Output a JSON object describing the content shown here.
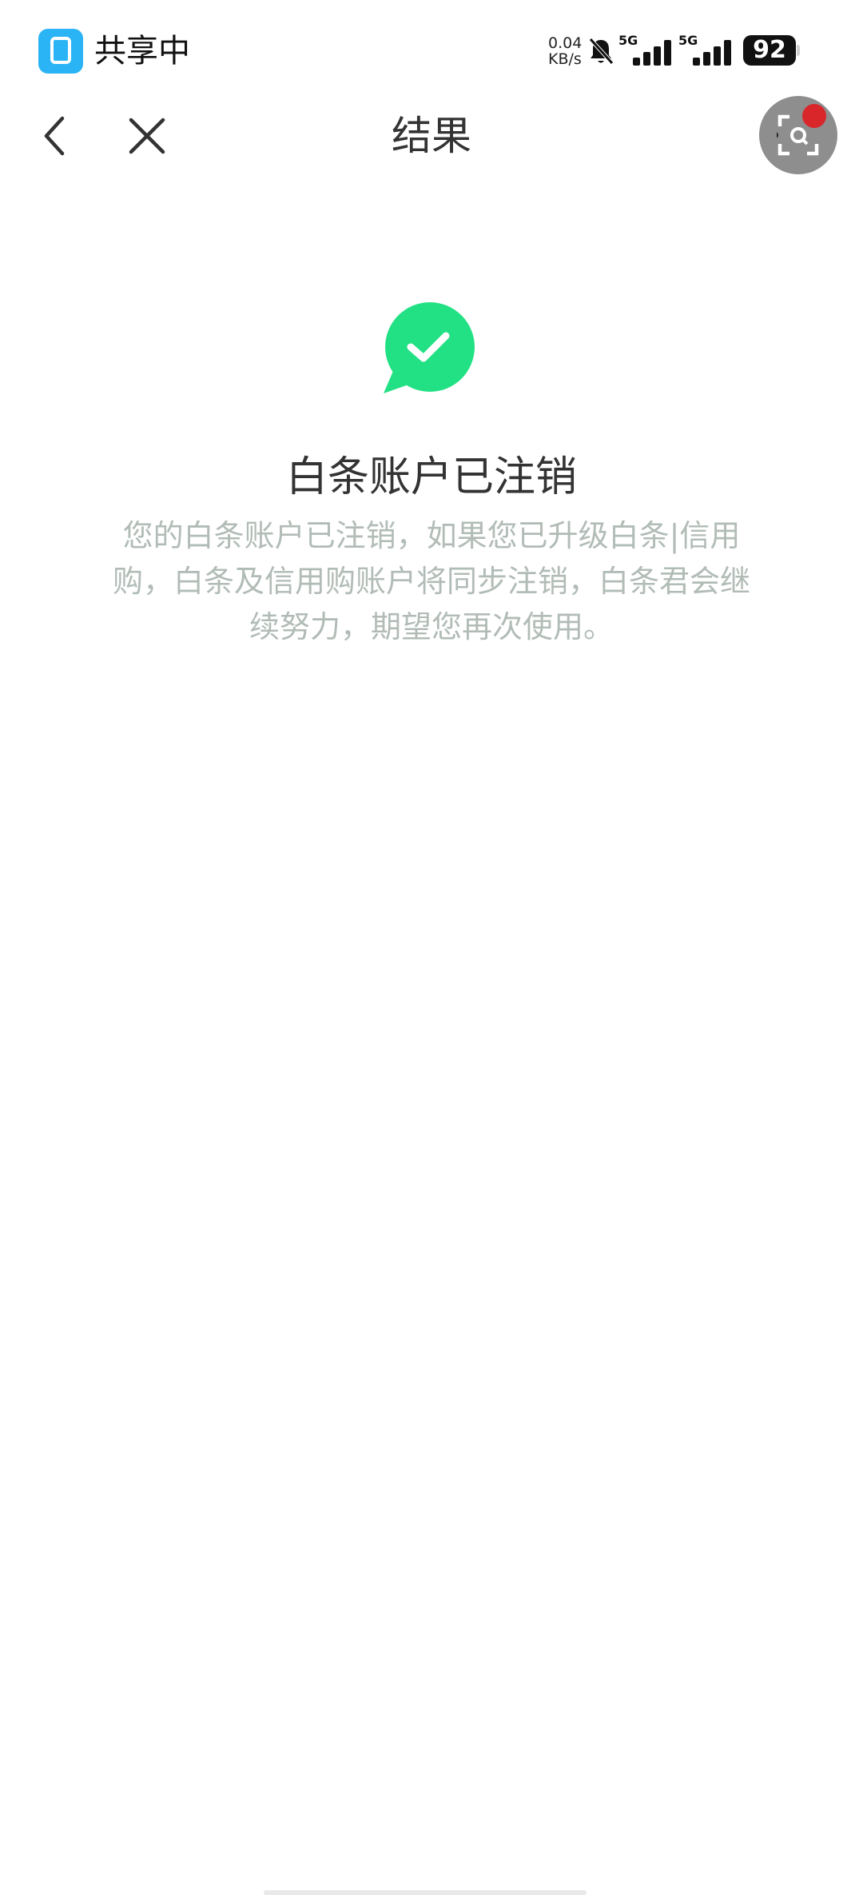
{
  "status_bar": {
    "share_label": "共享中",
    "net_speed_value": "0.04",
    "net_speed_unit": "KB/s",
    "signal_1_tag": "5G",
    "signal_2_tag": "5G",
    "battery_level": "92",
    "icons": [
      "screen-share-icon",
      "bell-off-icon",
      "signal-icon",
      "battery-icon"
    ]
  },
  "nav": {
    "title": "结果",
    "icons": [
      "chevron-left-icon",
      "close-icon",
      "scan-icon"
    ]
  },
  "result": {
    "icon": "check-bubble-icon",
    "title": "白条账户已注销",
    "description": "您的白条账户已注销，如果您已升级白条|信用购，白条及信用购账户将同步注销，白条君会继续努力，期望您再次使用。"
  },
  "colors": {
    "success_green": "#22e184",
    "description_gray": "#b2bcb6",
    "share_icon_blue": "#2ab4f5",
    "badge_red": "#d8262b"
  }
}
